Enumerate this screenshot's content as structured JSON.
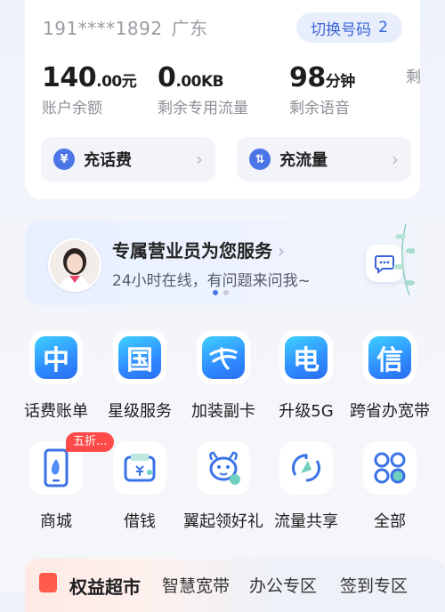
{
  "account": {
    "phone_number": "191****1892",
    "region": "广东",
    "switch_label": "切换号码",
    "switch_count": "2"
  },
  "stats": [
    {
      "value": "140",
      "unit": ".00元",
      "label": "账户余额"
    },
    {
      "value": "0",
      "unit": ".00KB",
      "label": "剩余专用流量"
    },
    {
      "value": "98",
      "unit": "分钟",
      "label": "剩余语音"
    },
    {
      "value": "",
      "unit": "",
      "label": "剩"
    }
  ],
  "recharge": [
    {
      "label": "充话费",
      "icon": "yen-icon"
    },
    {
      "label": "充流量",
      "icon": "data-icon"
    }
  ],
  "agent_banner": {
    "title": "专属营业员为您服务",
    "subtitle": "24小时在线，有问题来问我~"
  },
  "services": [
    {
      "label": "话费账单",
      "glyph": "中"
    },
    {
      "label": "星级服务",
      "glyph": "国"
    },
    {
      "label": "加装副卡",
      "glyph": "电信logo"
    },
    {
      "label": "升级5G",
      "glyph": "电"
    },
    {
      "label": "跨省办宽带",
      "glyph": "信"
    },
    {
      "label": "商城",
      "glyph": "phone-flame",
      "badge": "五折..."
    },
    {
      "label": "借钱",
      "glyph": "wallet"
    },
    {
      "label": "翼起领好礼",
      "glyph": "dragon"
    },
    {
      "label": "流量共享",
      "glyph": "share"
    },
    {
      "label": "全部",
      "glyph": "grid"
    }
  ],
  "bottom_tabs": [
    {
      "label": "权益超市",
      "active": true
    },
    {
      "label": "智慧宽带"
    },
    {
      "label": "办公专区"
    },
    {
      "label": "签到专区"
    }
  ],
  "colors": {
    "accent": "#3a63d8",
    "badge": "#ff4a4a"
  }
}
